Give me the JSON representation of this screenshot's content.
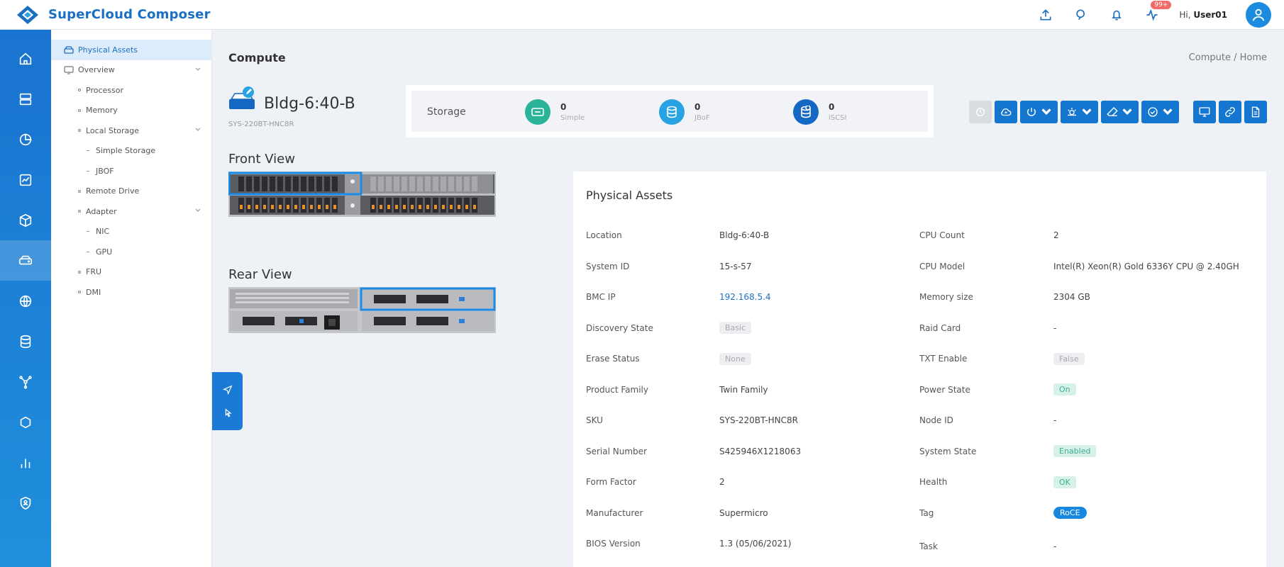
{
  "header": {
    "brand": "SuperCloud Composer",
    "notification_count": "99+",
    "greeting_prefix": "Hi, ",
    "username": "User01"
  },
  "rail": {
    "items": [
      "home",
      "servers",
      "pie-chart",
      "activity",
      "cube",
      "physical-assets",
      "globe",
      "database",
      "network",
      "hexagon",
      "bar-chart",
      "security"
    ]
  },
  "tree": {
    "items": [
      {
        "label": "Physical Assets",
        "level": 0,
        "icon": "hdd-icon"
      },
      {
        "label": "Overview",
        "level": 0,
        "icon": "monitor-icon"
      },
      {
        "label": "Processor",
        "level": 1
      },
      {
        "label": "Memory",
        "level": 1
      },
      {
        "label": "Local Storage",
        "level": 1
      },
      {
        "label": "Simple Storage",
        "level": 2
      },
      {
        "label": "JBOF",
        "level": 2
      },
      {
        "label": "Remote Drive",
        "level": 1
      },
      {
        "label": "Adapter",
        "level": 1
      },
      {
        "label": "NIC",
        "level": 2
      },
      {
        "label": "GPU",
        "level": 2
      },
      {
        "label": "FRU",
        "level": 1
      },
      {
        "label": "DMI",
        "level": 1
      }
    ]
  },
  "page": {
    "title": "Compute",
    "breadcrumb": "Compute / Home",
    "device_name": "Bldg-6:40-B",
    "device_sku": "SYS-220BT-HNC8R"
  },
  "storage": {
    "label": "Storage",
    "items": [
      {
        "count": "0",
        "name": "Simple",
        "color": "#2bb39a"
      },
      {
        "count": "0",
        "name": "JBoF",
        "color": "#27a3e3"
      },
      {
        "count": "0",
        "name": "iSCSI",
        "color": "#1467c2"
      }
    ]
  },
  "views": {
    "front": "Front View",
    "rear": "Rear View"
  },
  "panel": {
    "title": "Physical Assets",
    "left": [
      {
        "label": "Location",
        "value": "Bldg-6:40-B"
      },
      {
        "label": "System ID",
        "value": "15-s-57"
      },
      {
        "label": "BMC IP",
        "value": "192.168.5.4"
      },
      {
        "label": "Discovery State",
        "value": "Basic"
      },
      {
        "label": "Erase Status",
        "value": "None"
      },
      {
        "label": "Product Family",
        "value": "Twin Family"
      },
      {
        "label": "SKU",
        "value": "SYS-220BT-HNC8R"
      },
      {
        "label": "Serial Number",
        "value": "S425946X1218063"
      },
      {
        "label": "Form Factor",
        "value": "2"
      },
      {
        "label": "Manufacturer",
        "value": "Supermicro"
      },
      {
        "label": "BIOS Version",
        "value": "1.3 (05/06/2021)"
      }
    ],
    "right": [
      {
        "label": "CPU Count",
        "value": "2"
      },
      {
        "label": "CPU Model",
        "value": "Intel(R) Xeon(R) Gold 6336Y CPU @ 2.40GH"
      },
      {
        "label": "Memory size",
        "value": "2304 GB"
      },
      {
        "label": "Raid Card",
        "value": "-"
      },
      {
        "label": "TXT Enable",
        "value": "False"
      },
      {
        "label": "Power State",
        "value": "On"
      },
      {
        "label": "Node ID",
        "value": "-"
      },
      {
        "label": "System State",
        "value": "Enabled"
      },
      {
        "label": "Health",
        "value": "OK"
      },
      {
        "label": "Tag",
        "value": "RoCE"
      },
      {
        "label": "Task",
        "value": "-"
      }
    ]
  },
  "colors": {
    "accent": "#1576d0",
    "rail_top": "#1a73d0",
    "chip_green": "#3fae8c"
  }
}
